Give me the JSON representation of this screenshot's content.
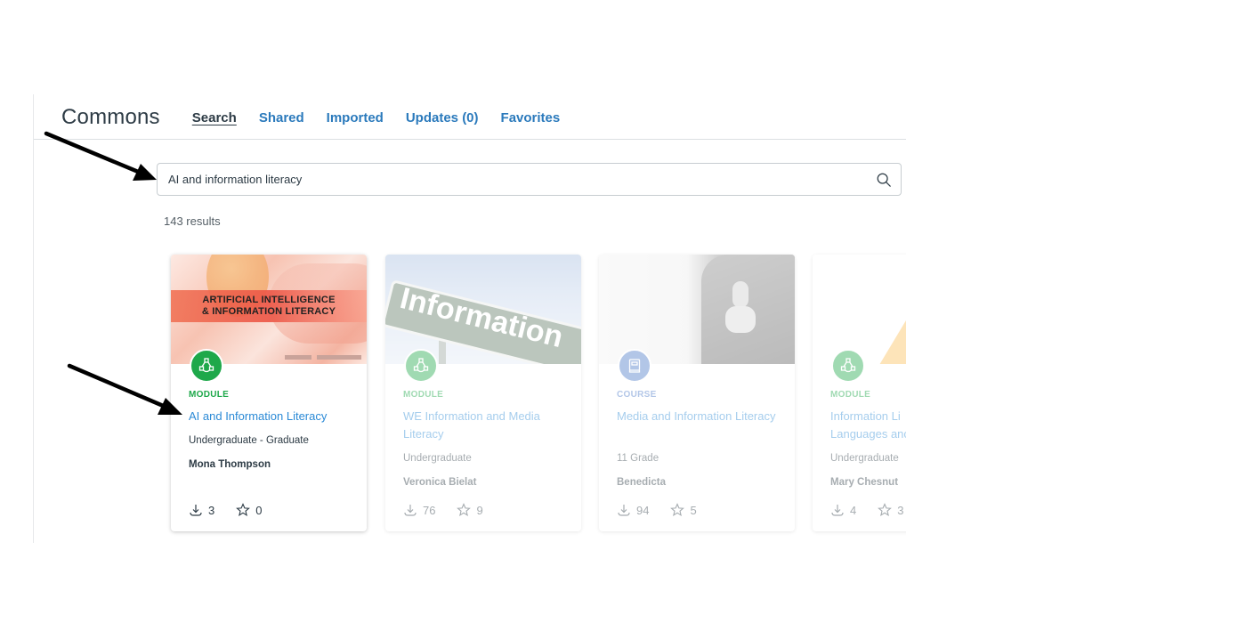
{
  "header": {
    "app_title": "Commons",
    "tabs": [
      {
        "label": "Search",
        "active": true
      },
      {
        "label": "Shared",
        "active": false
      },
      {
        "label": "Imported",
        "active": false
      },
      {
        "label": "Updates (0)",
        "active": false
      },
      {
        "label": "Favorites",
        "active": false
      }
    ]
  },
  "search": {
    "value": "AI and information literacy",
    "icon": "search-icon"
  },
  "results": {
    "count_text": "143 results"
  },
  "colors": {
    "link_blue": "#2b7abc",
    "module_green": "#1ea84a",
    "course_blue": "#8fb0e0",
    "title_blue": "#2b8ad6",
    "text_dark": "#2d3b45"
  },
  "cards": [
    {
      "type": "MODULE",
      "type_icon": "module-network-icon",
      "thumbnail_text_1": "ARTIFICIAL INTELLIGENCE",
      "thumbnail_text_2": "& INFORMATION LITERACY",
      "title": "AI and Information Literacy",
      "level": "Undergraduate - Graduate",
      "author": "Mona Thompson",
      "downloads": "3",
      "favorites": "0"
    },
    {
      "type": "MODULE",
      "type_icon": "module-network-icon",
      "thumbnail_text_1": "Information",
      "title": "WE Information and Media Literacy",
      "level": "Undergraduate",
      "author": "Veronica Bielat",
      "downloads": "76",
      "favorites": "9"
    },
    {
      "type": "COURSE",
      "type_icon": "course-book-icon",
      "title": "Media and Information Literacy",
      "level": "11 Grade",
      "author": "Benedicta",
      "downloads": "94",
      "favorites": "5"
    },
    {
      "type": "MODULE",
      "type_icon": "module-network-icon",
      "title": "Information Literacy: Languages and",
      "title_line_1": "Information Li",
      "title_line_2": "Languages anc",
      "level": "Undergraduate",
      "author": "Mary Chesnut",
      "downloads": "4",
      "favorites": "3"
    }
  ]
}
